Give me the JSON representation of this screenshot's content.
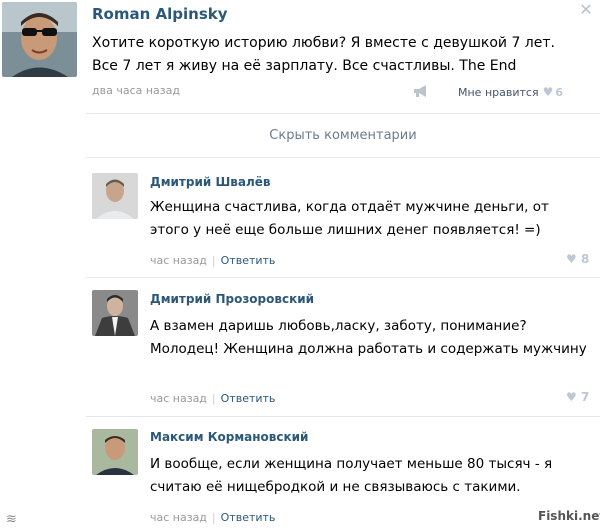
{
  "post": {
    "author": "Roman Alpinsky",
    "text": "Хотите короткую историю любви? Я вместе с девушкой 7 лет. Все 7 лет я живу на её зарплату. Все счастливы. The End",
    "time": "два часа назад",
    "like_label": "Мне нравится",
    "like_count": "6",
    "close_icon": "close-icon",
    "share_icon": "megaphone-icon"
  },
  "hide_comments_label": "Скрыть комментарии",
  "comments": [
    {
      "author": "Дмитрий Швалёв",
      "text": "Женщина счастлива, когда отдаёт мужчине деньги, от этого у неё еще больше лишних денег появляется! =)",
      "time": "час назад",
      "reply_label": "Ответить",
      "likes": "8"
    },
    {
      "author": "Дмитрий Прозоровский",
      "text": "А взамен даришь любовь,ласку, заботу, понимание? Молодец! Женщина должна работать и содержать мужчину",
      "time": "час назад",
      "reply_label": "Ответить",
      "likes": "7"
    },
    {
      "author": "Максим Кормановский",
      "text": "И вообще, если женщина получает меньше 80 тысяч - я считаю её нищебродкой и не связываюсь с такими.",
      "time": "час назад",
      "reply_label": "Ответить",
      "likes": ""
    }
  ],
  "watermark": {
    "left_symbol": "≋",
    "right": "Fishki.net"
  },
  "colors": {
    "link": "#2b587a",
    "meta": "#999999",
    "like_heart": "#bcc8d5"
  }
}
